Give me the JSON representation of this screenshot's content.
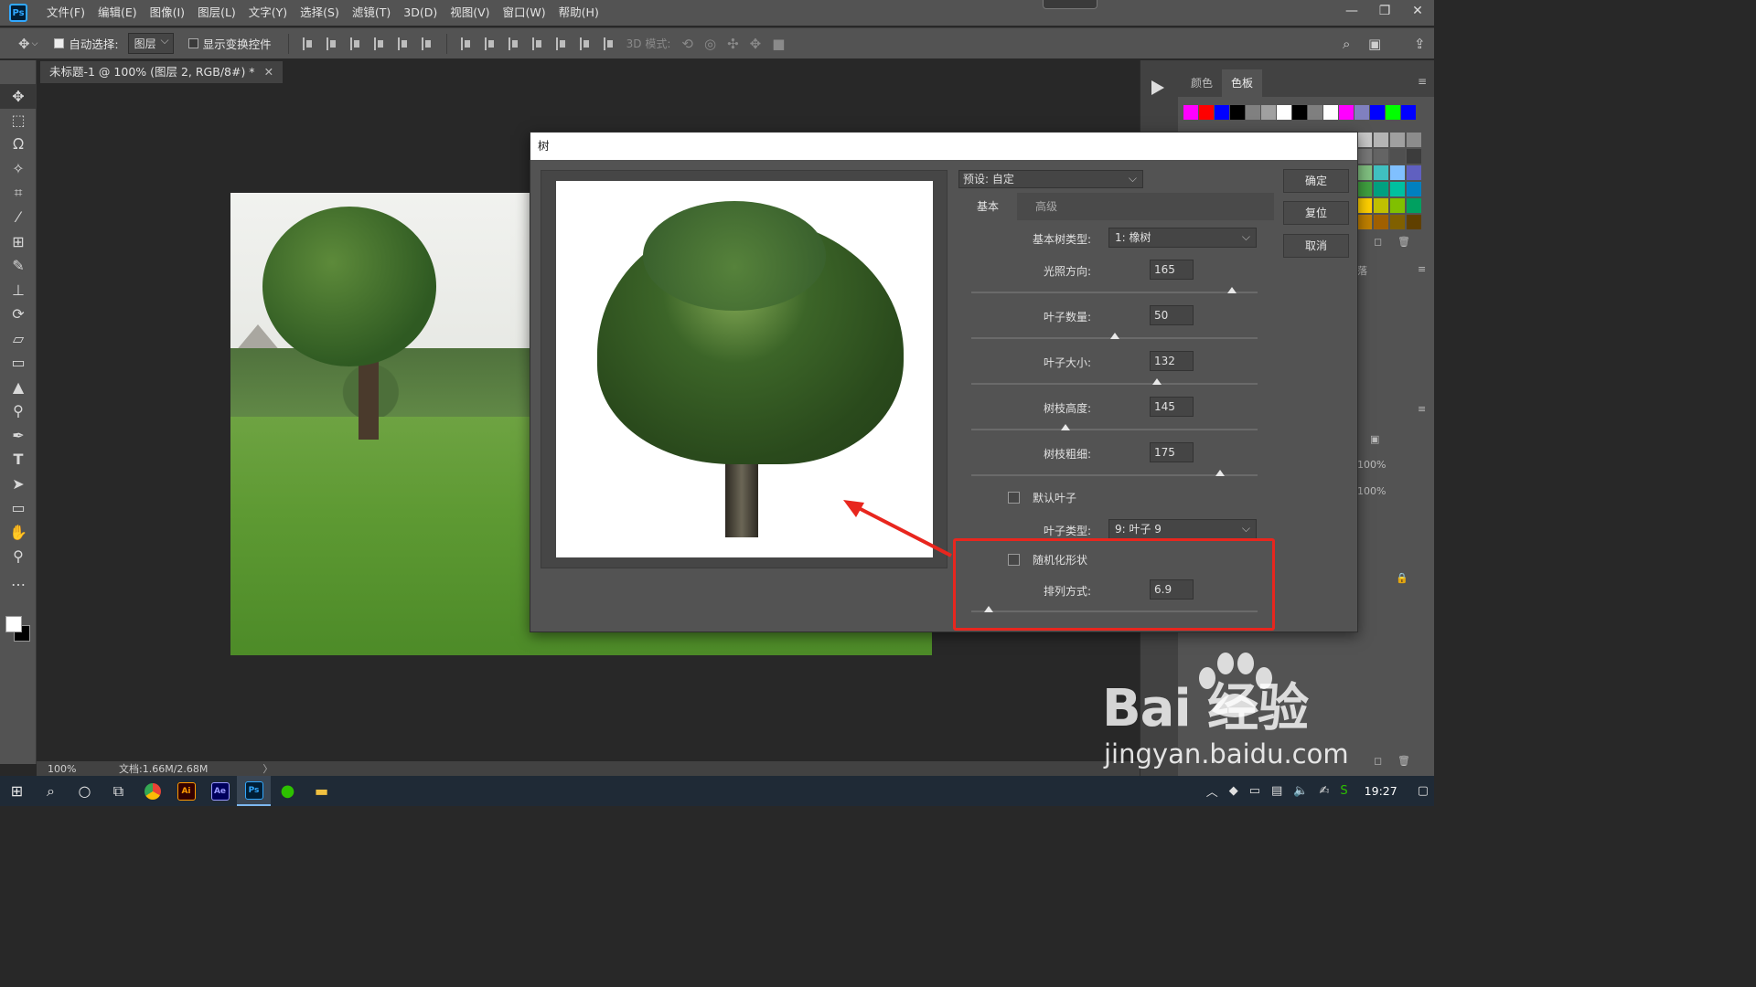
{
  "app": {
    "logo": "Ps",
    "menu": [
      "文件(F)",
      "编辑(E)",
      "图像(I)",
      "图层(L)",
      "文字(Y)",
      "选择(S)",
      "滤镜(T)",
      "3D(D)",
      "视图(V)",
      "窗口(W)",
      "帮助(H)"
    ]
  },
  "options": {
    "auto_select_label": "自动选择:",
    "auto_select_checked": true,
    "auto_select_target": "图层",
    "show_transform_label": "显示变换控件",
    "mode_3d_label": "3D 模式:"
  },
  "document": {
    "tab_title": "未标题-1 @ 100% (图层 2, RGB/8#) *",
    "zoom": "100%",
    "doc_size": "文档:1.66M/2.68M"
  },
  "panels": {
    "tabs": [
      "颜色",
      "色板"
    ],
    "active_tab": "色板",
    "swatch_colors": [
      "#ff00ff",
      "#ff0000",
      "#0000ff",
      "#000000",
      "#808080",
      "#a0a0a0",
      "#ffffff",
      "#000000",
      "#7f7f7f",
      "#ffffff",
      "#ff00ff",
      "#8080c0",
      "#0000ff",
      "#00ff00",
      "#0000ff"
    ],
    "grid_colors": [
      "#c8c8c8",
      "#b4b4b4",
      "#a0a0a0",
      "#8c8c8c",
      "#787878",
      "#646464",
      "#505050",
      "#3c3c3c",
      "#80c080",
      "#40c0c0",
      "#80c0ff",
      "#6060c0",
      "#40a040",
      "#00a080",
      "#00c0a0",
      "#0080c0",
      "#ffd000",
      "#c0c000",
      "#80c000",
      "#00a060",
      "#c08000",
      "#a06000",
      "#806000",
      "#604000"
    ],
    "pct_1": "100%",
    "pct_2": "100%",
    "collapsed_label": "落"
  },
  "dialog": {
    "title": "树",
    "preset_label": "预设: 自定",
    "tabs": [
      "基本",
      "高级"
    ],
    "active_tab": "基本",
    "tree_type_label": "基本树类型:",
    "tree_type_value": "1: 橡树",
    "fields": [
      {
        "label": "光照方向:",
        "value": "165",
        "slider_pct": 91
      },
      {
        "label": "叶子数量:",
        "value": "50",
        "slider_pct": 50
      },
      {
        "label": "叶子大小:",
        "value": "132",
        "slider_pct": 65
      },
      {
        "label": "树枝高度:",
        "value": "145",
        "slider_pct": 33
      },
      {
        "label": "树枝粗细:",
        "value": "175",
        "slider_pct": 87
      }
    ],
    "default_leaves_label": "默认叶子",
    "leaf_type_label": "叶子类型:",
    "leaf_type_value": "9: 叶子 9",
    "randomize_label": "随机化形状",
    "arrangement_label": "排列方式:",
    "arrangement_value": "6.9",
    "arrangement_slider_pct": 6,
    "buttons": {
      "ok": "确定",
      "reset": "复位",
      "cancel": "取消"
    }
  },
  "taskbar": {
    "time": "19:27",
    "apps": [
      "Ai",
      "Ae",
      "Ps"
    ]
  },
  "watermark": {
    "brand": "Bai  经验",
    "url": "jingyan.baidu.com"
  },
  "annotation": {
    "color": "#e8261e"
  }
}
